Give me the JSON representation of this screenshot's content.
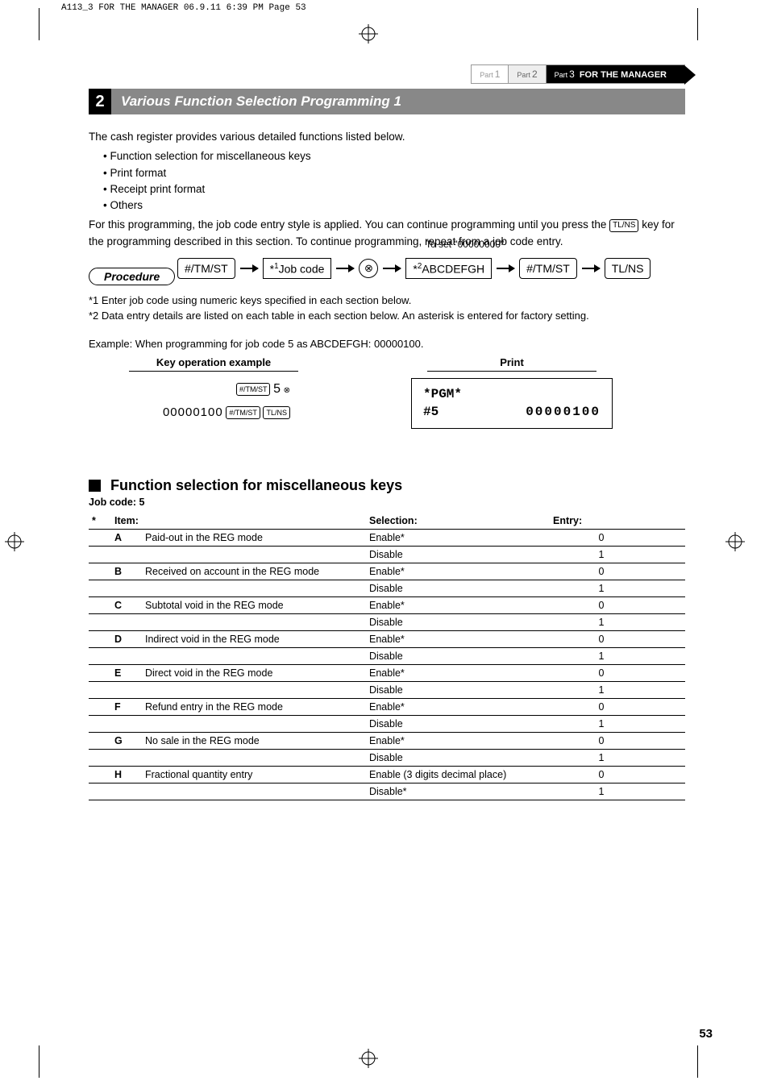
{
  "header_strip": "A113_3 FOR THE MANAGER   06.9.11 6:39 PM   Page 53",
  "tabs": {
    "part_label": "Part",
    "t1": "1",
    "t2": "2",
    "t3": "3",
    "manager": "FOR THE MANAGER"
  },
  "section": {
    "num": "2",
    "title": "Various Function Selection Programming 1"
  },
  "intro": {
    "lead": "The cash register provides various detailed functions listed below.",
    "items": [
      "Function selection for miscellaneous keys",
      "Print format",
      "Receipt print format",
      "Others"
    ],
    "para1": "For this programming, the job code entry style is applied.  You can continue programming until you press the",
    "para1_key": "TL/NS",
    "para1_end": " key for the programming described in this section.  To continue programming, repeat from a job code entry."
  },
  "procedure_label": "Procedure",
  "flow": {
    "toset": "To set \"00000000\"",
    "b1": "#/TM/ST",
    "b2_pre": "*",
    "b2_sup": "1",
    "b2_post": "Job code",
    "circle": "⊗",
    "b3_pre": "*",
    "b3_sup": "2",
    "b3_post": "ABCDEFGH",
    "b4": "#/TM/ST",
    "b5": "TL/NS"
  },
  "notes": {
    "n1": "*1  Enter job code using numeric keys specified in each section below.",
    "n2": "*2  Data entry details are listed on each table in each section below.  An asterisk is entered for factory setting."
  },
  "example_line": "Example:  When programming for job code 5 as ABCDEFGH: 00000100.",
  "example_headers": {
    "key": "Key operation example",
    "print": "Print"
  },
  "keyop": {
    "line1_key": "#/TM/ST",
    "line1_num": "5",
    "line1_sym": "⊗",
    "line2_num": "00000100",
    "line2_key1": "#/TM/ST",
    "line2_key2": "TL/NS"
  },
  "print_box": {
    "l1": "*PGM*",
    "l2a": "#5",
    "l2b": "00000100"
  },
  "subsection": {
    "title": "Function selection for miscellaneous keys",
    "jobcode": "Job code:  5"
  },
  "table": {
    "headers": {
      "star": "*",
      "item": "Item:",
      "selection": "Selection:",
      "entry": "Entry:"
    },
    "rows": [
      {
        "item": "A",
        "desc": "Paid-out in the REG mode",
        "sel": "Enable*",
        "entry": "0"
      },
      {
        "item": "",
        "desc": "",
        "sel": "Disable",
        "entry": "1",
        "thick": true
      },
      {
        "item": "B",
        "desc": "Received on account in the REG mode",
        "sel": "Enable*",
        "entry": "0"
      },
      {
        "item": "",
        "desc": "",
        "sel": "Disable",
        "entry": "1",
        "thick": true
      },
      {
        "item": "C",
        "desc": "Subtotal void in the REG mode",
        "sel": "Enable*",
        "entry": "0"
      },
      {
        "item": "",
        "desc": "",
        "sel": "Disable",
        "entry": "1",
        "thick": true
      },
      {
        "item": "D",
        "desc": "Indirect void in the REG mode",
        "sel": "Enable*",
        "entry": "0"
      },
      {
        "item": "",
        "desc": "",
        "sel": "Disable",
        "entry": "1",
        "thick": true
      },
      {
        "item": "E",
        "desc": "Direct void in the REG mode",
        "sel": "Enable*",
        "entry": "0"
      },
      {
        "item": "",
        "desc": "",
        "sel": "Disable",
        "entry": "1",
        "thick": true
      },
      {
        "item": "F",
        "desc": "Refund entry in the REG mode",
        "sel": "Enable*",
        "entry": "0"
      },
      {
        "item": "",
        "desc": "",
        "sel": "Disable",
        "entry": "1",
        "thick": true
      },
      {
        "item": "G",
        "desc": "No sale in the REG mode",
        "sel": "Enable*",
        "entry": "0"
      },
      {
        "item": "",
        "desc": "",
        "sel": "Disable",
        "entry": "1",
        "thick": true
      },
      {
        "item": "H",
        "desc": "Fractional quantity entry",
        "sel": "Enable (3 digits decimal place)",
        "entry": "0"
      },
      {
        "item": "",
        "desc": "",
        "sel": "Disable*",
        "entry": "1",
        "thick": true
      }
    ]
  },
  "page_num": "53"
}
